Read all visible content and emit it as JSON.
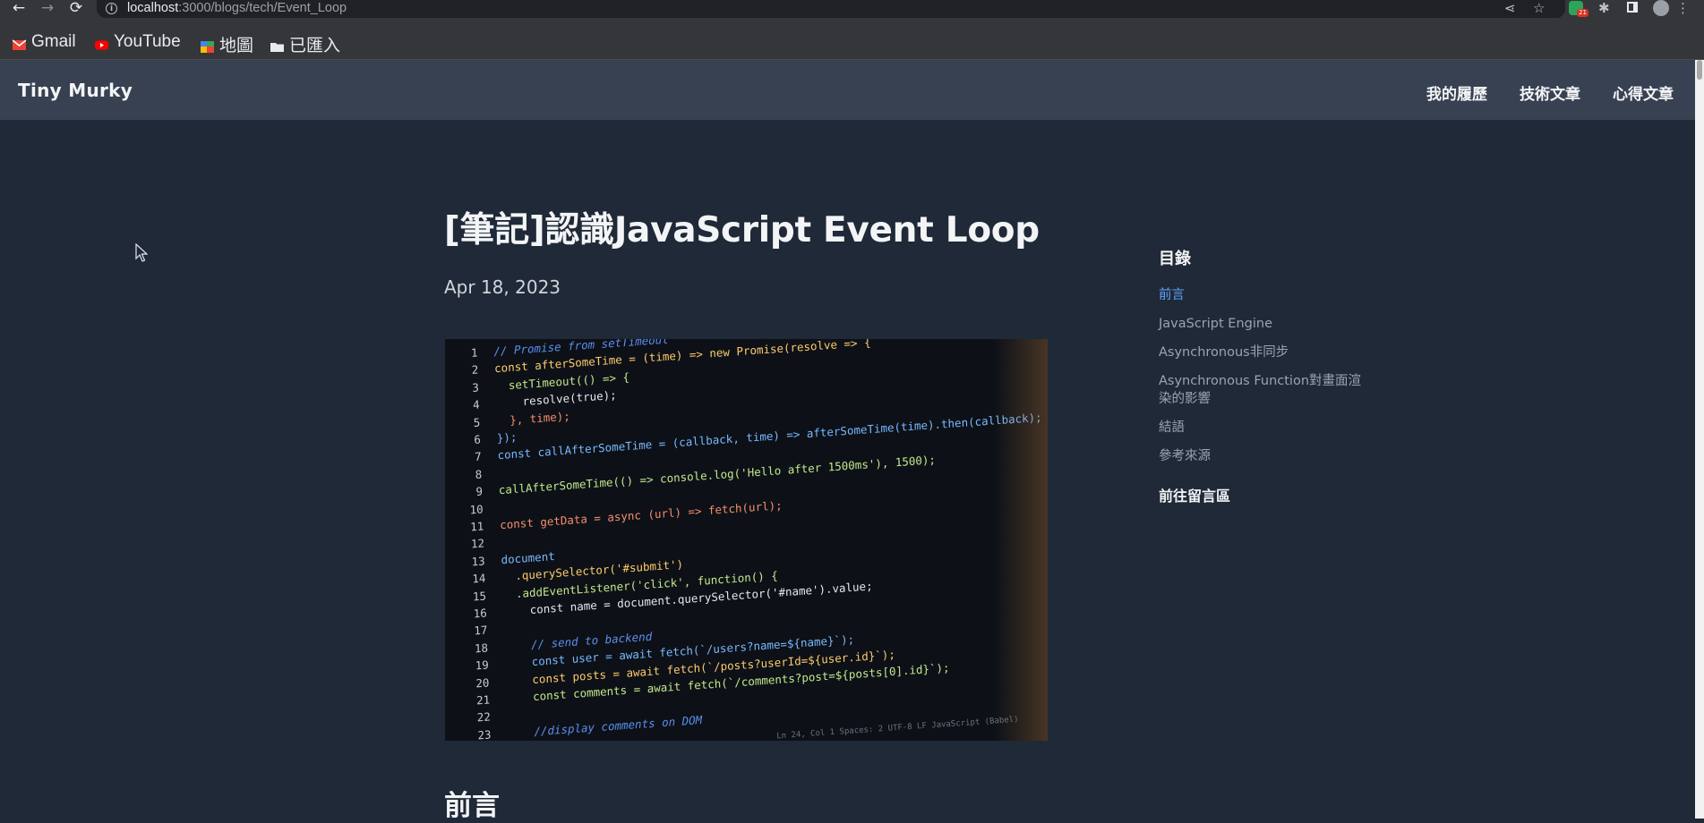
{
  "browser": {
    "url_host": "localhost",
    "url_path": ":3000/blogs/tech/Event_Loop",
    "bookmarks": [
      {
        "label": "Gmail",
        "icon": "gmail-icon"
      },
      {
        "label": "YouTube",
        "icon": "youtube-icon"
      },
      {
        "label": "地圖",
        "icon": "maps-icon"
      },
      {
        "label": "已匯入",
        "icon": "folder-icon"
      }
    ],
    "extension_badge": "21"
  },
  "site": {
    "logo": "Tiny Murky",
    "nav": [
      "我的履歷",
      "技術文章",
      "心得文章"
    ]
  },
  "article": {
    "title": "[筆記]認識JavaScript Event Loop",
    "date": "Apr 18, 2023",
    "first_heading": "前言"
  },
  "hero_code": [
    {
      "n": "1",
      "t": "// Promise from setTimeout"
    },
    {
      "n": "2",
      "t": "const afterSomeTime = (time) => new Promise(resolve => {"
    },
    {
      "n": "3",
      "t": "  setTimeout(() => {"
    },
    {
      "n": "4",
      "t": "    resolve(true);"
    },
    {
      "n": "5",
      "t": "  }, time);"
    },
    {
      "n": "6",
      "t": "});"
    },
    {
      "n": "7",
      "t": "const callAfterSomeTime = (callback, time) => afterSomeTime(time).then(callback);"
    },
    {
      "n": "8",
      "t": ""
    },
    {
      "n": "9",
      "t": "callAfterSomeTime(() => console.log('Hello after 1500ms'), 1500);"
    },
    {
      "n": "10",
      "t": ""
    },
    {
      "n": "11",
      "t": "const getData = async (url) => fetch(url);"
    },
    {
      "n": "12",
      "t": ""
    },
    {
      "n": "13",
      "t": "document"
    },
    {
      "n": "14",
      "t": "  .querySelector('#submit')"
    },
    {
      "n": "15",
      "t": "  .addEventListener('click', function() {"
    },
    {
      "n": "16",
      "t": "    const name = document.querySelector('#name').value;"
    },
    {
      "n": "17",
      "t": ""
    },
    {
      "n": "18",
      "t": "    // send to backend"
    },
    {
      "n": "19",
      "t": "    const user = await fetch(`/users?name=${name}`);"
    },
    {
      "n": "20",
      "t": "    const posts = await fetch(`/posts?userId=${user.id}`);"
    },
    {
      "n": "21",
      "t": "    const comments = await fetch(`/comments?post=${posts[0].id}`);"
    },
    {
      "n": "22",
      "t": ""
    },
    {
      "n": "23",
      "t": "    //display comments on DOM"
    }
  ],
  "hero_status": "Ln 24, Col 1   Spaces: 2   UTF-8   LF   JavaScript (Babel)",
  "toc": {
    "heading": "目錄",
    "items": [
      {
        "label": "前言",
        "active": true
      },
      {
        "label": "JavaScript Engine",
        "active": false
      },
      {
        "label": "Asynchronous非同步",
        "active": false
      },
      {
        "label": "Asynchronous Function對畫面渲染的影響",
        "active": false
      },
      {
        "label": "結語",
        "active": false
      },
      {
        "label": "參考來源",
        "active": false
      }
    ],
    "comments_link": "前往留言區"
  },
  "colors": {
    "page_bg": "#1f2937",
    "header_bg": "#374151",
    "toc_active": "#60a5fa",
    "toc_inactive": "#9ca3af"
  }
}
